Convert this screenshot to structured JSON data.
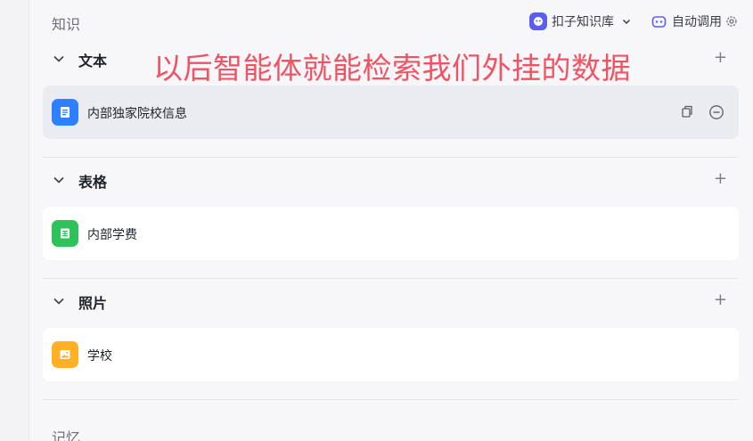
{
  "header": {
    "title": "知识",
    "kb_selector_label": "扣子知识库",
    "auto_call_label": "自动调用"
  },
  "annotation": "以后智能体就能检索我们外挂的数据",
  "sections": [
    {
      "label": "文本",
      "items": [
        {
          "label": "内部独家院校信息",
          "icon": "document-icon",
          "color": "#2f80ff"
        }
      ]
    },
    {
      "label": "表格",
      "items": [
        {
          "label": "内部学费",
          "icon": "table-icon",
          "color": "#2fc25b"
        }
      ]
    },
    {
      "label": "照片",
      "items": [
        {
          "label": "学校",
          "icon": "image-icon",
          "color": "#ffb024"
        }
      ]
    }
  ],
  "memory": {
    "title": "记忆"
  },
  "colors": {
    "accent": "#5b5ef0",
    "annotation": "#f05363"
  }
}
